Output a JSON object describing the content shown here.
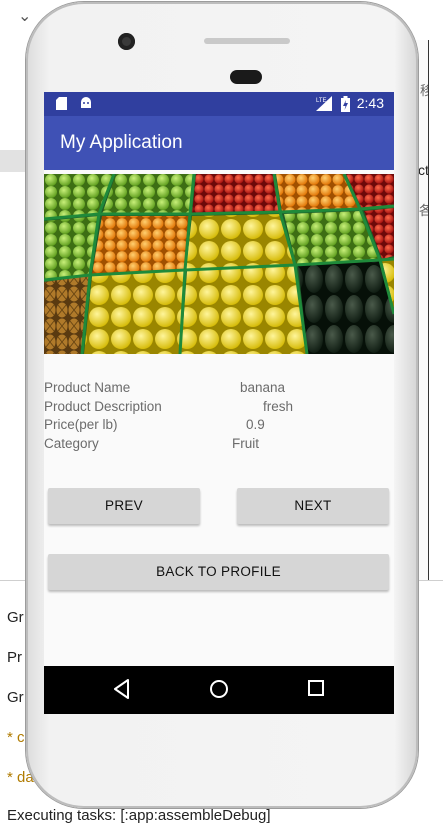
{
  "ide": {
    "console_lines": [
      "Gr",
      "Pr",
      "Gr",
      "* c",
      "* da",
      "Executing tasks: [:app:assembleDebug]"
    ],
    "right_panel_glyphs": [
      "移",
      "ct",
      "各"
    ]
  },
  "statusbar": {
    "time": "2:43",
    "icons": [
      "sd-card-icon",
      "android-icon",
      "lte-icon",
      "battery-icon"
    ]
  },
  "appbar": {
    "title": "My Application"
  },
  "product": {
    "labels": {
      "name": "Product Name",
      "description": "Product Description",
      "price": "Price(per lb)",
      "category": "Category"
    },
    "values": {
      "name": "banana",
      "description": "fresh",
      "price": "0.9",
      "category": "Fruit"
    }
  },
  "buttons": {
    "prev": "PREV",
    "next": "NEXT",
    "back": "BACK TO PROFILE"
  },
  "navbar": {
    "icons": [
      "back-icon",
      "home-icon",
      "recents-icon"
    ]
  },
  "colors": {
    "statusbar": "#303f9f",
    "appbar": "#3f51b5",
    "button": "#d6d6d6"
  }
}
